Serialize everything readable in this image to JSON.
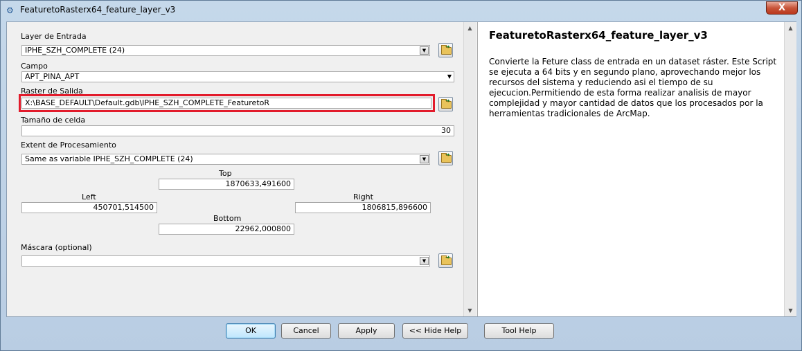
{
  "window": {
    "title": "FeaturetoRasterx64_feature_layer_v3",
    "close_label": "X"
  },
  "form": {
    "layer_label": "Layer de Entrada",
    "layer_value": "IPHE_SZH_COMPLETE (24)",
    "campo_label": "Campo",
    "campo_value": "APT_PINA_APT",
    "raster_label": "Raster de Salida",
    "raster_value": "X:\\BASE_DEFAULT\\Default.gdb\\IPHE_SZH_COMPLETE_FeaturetoR",
    "cell_label": "Tamaño de celda",
    "cell_value": "30",
    "extent_label": "Extent de Procesamiento",
    "extent_value": "Same as variable IPHE_SZH_COMPLETE (24)",
    "top_label": "Top",
    "top_value": "1870633,491600",
    "left_label": "Left",
    "left_value": "450701,514500",
    "right_label": "Right",
    "right_value": "1806815,896600",
    "bottom_label": "Bottom",
    "bottom_value": "22962,000800",
    "mask_label": "Máscara (optional)",
    "mask_value": ""
  },
  "help": {
    "title": "FeaturetoRasterx64_feature_layer_v3",
    "body": "Convierte la Feture class de entrada en un dataset ráster. Este Script se ejecuta a 64 bits y en segundo plano, aprovechando mejor los recursos del sistema y reduciendo asi el tiempo de su ejecucion.Permitiendo de esta forma realizar analisis de mayor complejidad y mayor cantidad de datos que los procesados por la herramientas tradicionales de ArcMap."
  },
  "buttons": {
    "ok": "OK",
    "cancel": "Cancel",
    "apply": "Apply",
    "hide_help": "<< Hide Help",
    "tool_help": "Tool Help"
  },
  "colors": {
    "highlight": "#e21b2b",
    "window_frame": "#bcd1e6"
  }
}
